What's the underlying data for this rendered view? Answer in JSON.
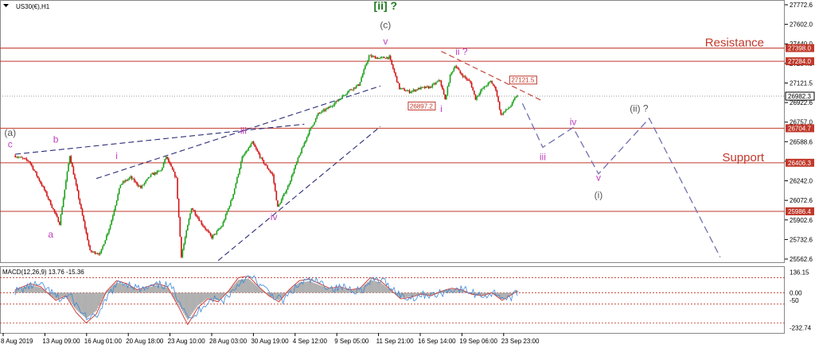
{
  "chart_data": {
    "type": "candlestick",
    "symbol_label": "US30(€),H1",
    "colors": {
      "up": "#1aa01a",
      "down": "#d21414",
      "level": "#c0392b",
      "wave_purple": "#c040c0",
      "wave_green": "#1f7a1f",
      "wave_gray": "#555555",
      "trend_navy": "#2c2c7a",
      "projection": "#7070b0",
      "macd_hist": "#b0b0b0",
      "macd_signal": "#d0403a",
      "macd_main": "#3a8ad8"
    },
    "price_axis": {
      "range": [
        25560,
        27800
      ],
      "ticks": [
        "27772.6",
        "27602.0",
        "27440.0",
        "27284.0",
        "27121.5",
        "26922.6",
        "26757.0",
        "26588.6",
        "26424.0",
        "26242.0",
        "26072.6",
        "25902.6",
        "25732.6",
        "25562.6"
      ]
    },
    "time_axis_labels": [
      "8 Aug 2019",
      "13 Aug 09:00",
      "16 Aug 01:00",
      "20 Aug 18:00",
      "23 Aug 10:00",
      "28 Aug 03:00",
      "30 Aug 19:00",
      "4 Sep 12:00",
      "9 Sep 05:00",
      "11 Sep 21:00",
      "16 Sep 14:00",
      "19 Sep 06:00",
      "23 Sep 23:00"
    ],
    "levels": [
      {
        "price": 27398.0,
        "label": "27398.0",
        "text": "Resistance"
      },
      {
        "price": 27284.0,
        "label": "27284.0",
        "text": ""
      },
      {
        "price": 26704.7,
        "label": "26704.7",
        "text": ""
      },
      {
        "price": 26406.3,
        "label": "26406.3",
        "text": "Support"
      },
      {
        "price": 25986.4,
        "label": "25986.4",
        "text": ""
      }
    ],
    "current_price": {
      "price": 26982.3,
      "label": "26982.3"
    },
    "price_marks": [
      {
        "label": "26897.2",
        "price": 26897.2
      },
      {
        "label": "27121.5",
        "price": 27121.5
      }
    ],
    "path": [
      {
        "t": 0,
        "p": 26470
      },
      {
        "t": 3,
        "p": 26420
      },
      {
        "t": 6,
        "p": 26170
      },
      {
        "t": 9,
        "p": 25880
      },
      {
        "t": 11,
        "p": 26470
      },
      {
        "t": 13,
        "p": 26050
      },
      {
        "t": 15,
        "p": 25640
      },
      {
        "t": 17,
        "p": 25620
      },
      {
        "t": 19,
        "p": 25870
      },
      {
        "t": 21,
        "p": 26220
      },
      {
        "t": 23,
        "p": 26280
      },
      {
        "t": 25,
        "p": 26190
      },
      {
        "t": 27,
        "p": 26300
      },
      {
        "t": 29,
        "p": 26340
      },
      {
        "t": 30,
        "p": 26460
      },
      {
        "t": 32,
        "p": 26270
      },
      {
        "t": 33,
        "p": 25600
      },
      {
        "t": 35,
        "p": 26020
      },
      {
        "t": 37,
        "p": 25880
      },
      {
        "t": 39,
        "p": 25760
      },
      {
        "t": 41,
        "p": 25860
      },
      {
        "t": 43,
        "p": 26100
      },
      {
        "t": 45,
        "p": 26450
      },
      {
        "t": 47,
        "p": 26580
      },
      {
        "t": 49,
        "p": 26420
      },
      {
        "t": 51,
        "p": 26300
      },
      {
        "t": 52,
        "p": 26020
      },
      {
        "t": 54,
        "p": 26200
      },
      {
        "t": 56,
        "p": 26440
      },
      {
        "t": 58,
        "p": 26660
      },
      {
        "t": 60,
        "p": 26830
      },
      {
        "t": 62,
        "p": 26880
      },
      {
        "t": 64,
        "p": 26950
      },
      {
        "t": 66,
        "p": 27030
      },
      {
        "t": 68,
        "p": 27080
      },
      {
        "t": 70,
        "p": 27330
      },
      {
        "t": 72,
        "p": 27310
      },
      {
        "t": 74,
        "p": 27320
      },
      {
        "t": 76,
        "p": 27050
      },
      {
        "t": 78,
        "p": 27020
      },
      {
        "t": 80,
        "p": 27050
      },
      {
        "t": 82,
        "p": 27060
      },
      {
        "t": 84,
        "p": 27120
      },
      {
        "t": 85,
        "p": 26950
      },
      {
        "t": 86,
        "p": 27160
      },
      {
        "t": 87,
        "p": 27250
      },
      {
        "t": 88,
        "p": 27180
      },
      {
        "t": 90,
        "p": 27100
      },
      {
        "t": 91,
        "p": 26960
      },
      {
        "t": 92,
        "p": 27030
      },
      {
        "t": 94,
        "p": 27110
      },
      {
        "t": 95,
        "p": 27040
      },
      {
        "t": 96,
        "p": 26820
      },
      {
        "t": 97,
        "p": 26860
      },
      {
        "t": 98,
        "p": 26900
      },
      {
        "t": 99,
        "p": 26982
      }
    ],
    "wave_labels": [
      {
        "text": "(a)",
        "t": -1,
        "p": 26640,
        "color": "wave_gray"
      },
      {
        "text": "c",
        "t": -1,
        "p": 26540,
        "color": "wave_purple"
      },
      {
        "text": "b",
        "t": 8,
        "p": 26580,
        "color": "wave_purple"
      },
      {
        "text": "a",
        "t": 7,
        "p": 25760,
        "color": "wave_purple"
      },
      {
        "text": "i",
        "t": 20,
        "p": 26440,
        "color": "wave_purple"
      },
      {
        "text": "iii",
        "t": 45,
        "p": 26655,
        "color": "wave_purple"
      },
      {
        "text": "iv",
        "t": 51,
        "p": 25910,
        "color": "wave_purple"
      },
      {
        "text": "[ii] ?",
        "t": 73,
        "p": 27730,
        "color": "wave_green"
      },
      {
        "text": "(c)",
        "t": 73,
        "p": 27570,
        "color": "wave_gray"
      },
      {
        "text": "v",
        "t": 73,
        "p": 27430,
        "color": "wave_purple"
      },
      {
        "text": "ii ?",
        "t": 88,
        "p": 27340,
        "color": "wave_purple"
      },
      {
        "text": "i",
        "t": 84,
        "p": 26845,
        "color": "wave_purple"
      },
      {
        "text": "iii",
        "t": 104,
        "p": 26430,
        "color": "wave_purple"
      },
      {
        "text": "iv",
        "t": 110,
        "p": 26730,
        "color": "wave_purple"
      },
      {
        "text": "v",
        "t": 115,
        "p": 26250,
        "color": "wave_purple"
      },
      {
        "text": "(i)",
        "t": 115,
        "p": 26100,
        "color": "wave_gray"
      },
      {
        "text": "(ii) ?",
        "t": 123,
        "p": 26850,
        "color": "wave_gray"
      }
    ],
    "projection": [
      {
        "t": 100,
        "p": 26920
      },
      {
        "t": 104,
        "p": 26540
      },
      {
        "t": 110,
        "p": 26710
      },
      {
        "t": 115,
        "p": 26310
      },
      {
        "t": 125,
        "p": 26790
      },
      {
        "t": 139,
        "p": 25590
      }
    ],
    "trendlines": [
      {
        "from": {
          "t": 16,
          "p": 26270
        },
        "to": {
          "t": 72,
          "p": 27070
        },
        "color": "trend_navy"
      },
      {
        "from": {
          "t": 0,
          "p": 26480
        },
        "to": {
          "t": 57,
          "p": 26740
        },
        "color": "trend_navy"
      },
      {
        "from": {
          "t": 40,
          "p": 25560
        },
        "to": {
          "t": 72,
          "p": 26720
        },
        "color": "trend_navy"
      },
      {
        "from": {
          "t": 84,
          "p": 27370
        },
        "to": {
          "t": 104,
          "p": 26940
        },
        "color": "level"
      }
    ],
    "macd": {
      "label": "MACD(12,26,9) 13.76 -15.36",
      "range": [
        -250,
        160
      ],
      "ticks": [
        "136.15",
        "0.00",
        "-50",
        "-232.74"
      ],
      "dotted_levels": [
        100,
        0,
        -75,
        -200
      ],
      "series": [
        {
          "t": 0,
          "v": 20
        },
        {
          "t": 3,
          "v": 60
        },
        {
          "t": 5,
          "v": 40
        },
        {
          "t": 8,
          "v": -50
        },
        {
          "t": 10,
          "v": -20
        },
        {
          "t": 12,
          "v": -130
        },
        {
          "t": 14,
          "v": -200
        },
        {
          "t": 16,
          "v": -140
        },
        {
          "t": 18,
          "v": 10
        },
        {
          "t": 20,
          "v": 80
        },
        {
          "t": 22,
          "v": 60
        },
        {
          "t": 24,
          "v": 20
        },
        {
          "t": 26,
          "v": 40
        },
        {
          "t": 28,
          "v": 60
        },
        {
          "t": 30,
          "v": 40
        },
        {
          "t": 32,
          "v": -80
        },
        {
          "t": 34,
          "v": -210
        },
        {
          "t": 36,
          "v": -100
        },
        {
          "t": 38,
          "v": -40
        },
        {
          "t": 40,
          "v": -60
        },
        {
          "t": 42,
          "v": 10
        },
        {
          "t": 44,
          "v": 100
        },
        {
          "t": 46,
          "v": 110
        },
        {
          "t": 48,
          "v": 40
        },
        {
          "t": 50,
          "v": -20
        },
        {
          "t": 52,
          "v": -60
        },
        {
          "t": 54,
          "v": 20
        },
        {
          "t": 56,
          "v": 80
        },
        {
          "t": 58,
          "v": 90
        },
        {
          "t": 60,
          "v": 60
        },
        {
          "t": 62,
          "v": 30
        },
        {
          "t": 64,
          "v": 40
        },
        {
          "t": 66,
          "v": 20
        },
        {
          "t": 68,
          "v": 30
        },
        {
          "t": 70,
          "v": 100
        },
        {
          "t": 72,
          "v": 80
        },
        {
          "t": 74,
          "v": 20
        },
        {
          "t": 76,
          "v": -40
        },
        {
          "t": 78,
          "v": -30
        },
        {
          "t": 80,
          "v": -10
        },
        {
          "t": 82,
          "v": -20
        },
        {
          "t": 84,
          "v": 10
        },
        {
          "t": 86,
          "v": 30
        },
        {
          "t": 88,
          "v": 20
        },
        {
          "t": 90,
          "v": -10
        },
        {
          "t": 92,
          "v": -20
        },
        {
          "t": 94,
          "v": 0
        },
        {
          "t": 96,
          "v": -50
        },
        {
          "t": 98,
          "v": -10
        },
        {
          "t": 99,
          "v": 14
        }
      ]
    }
  }
}
